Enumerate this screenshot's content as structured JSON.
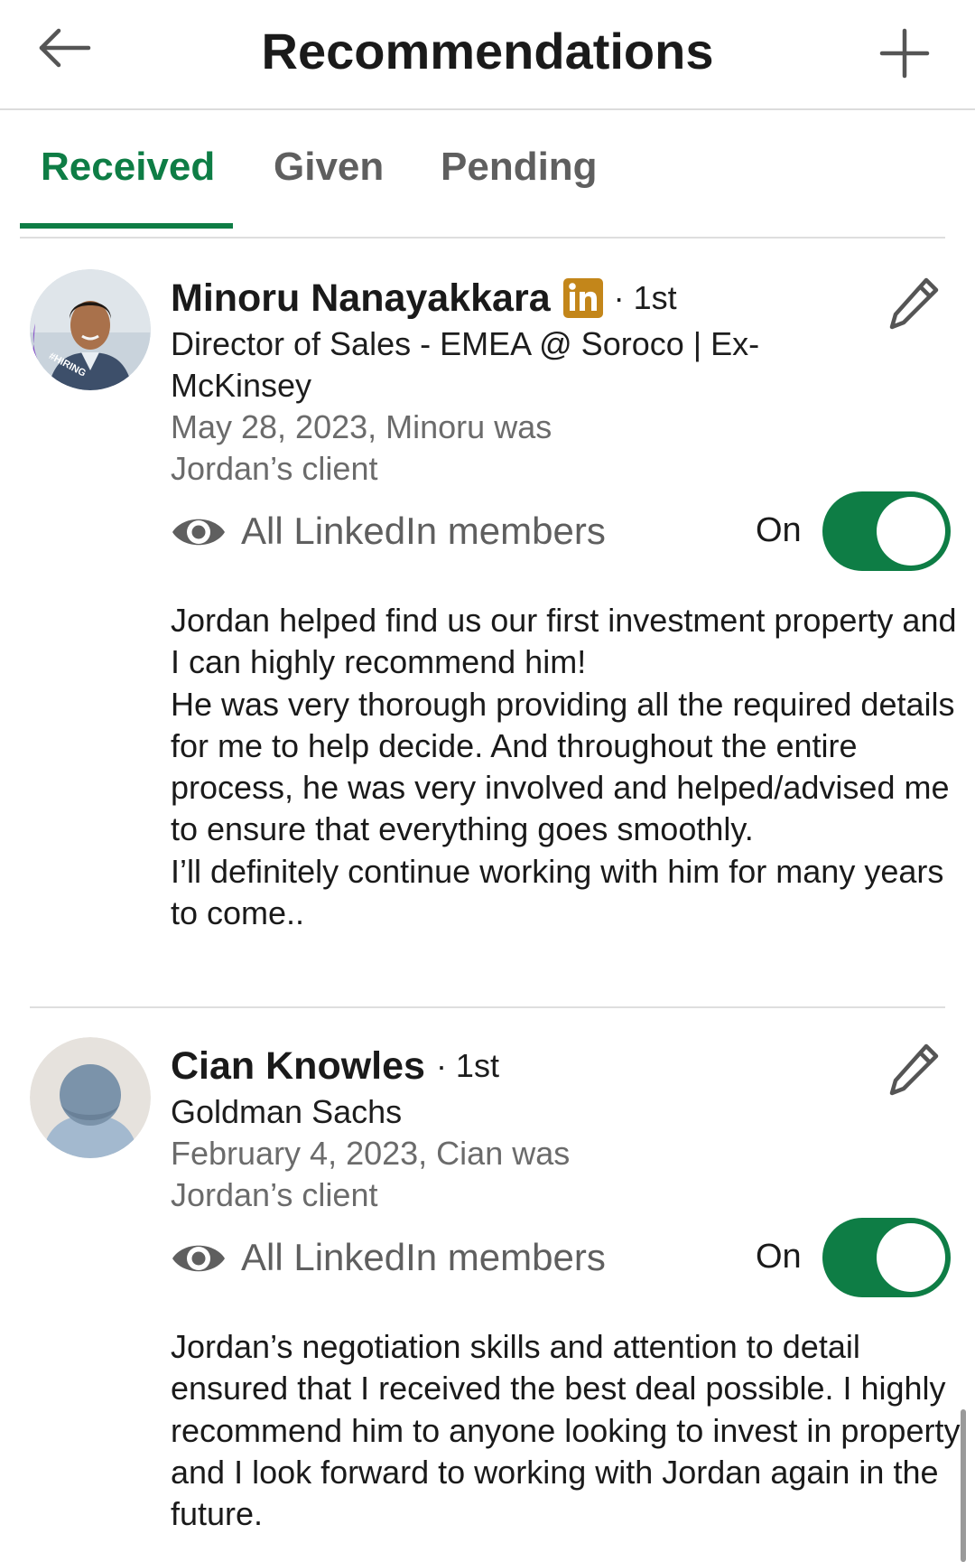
{
  "header": {
    "title": "Recommendations",
    "back_icon": "arrow-left-icon",
    "add_icon": "plus-icon"
  },
  "tabs": [
    {
      "label": "Received",
      "active": true
    },
    {
      "label": "Given",
      "active": false
    },
    {
      "label": "Pending",
      "active": false
    }
  ],
  "colors": {
    "accent": "#0e7d45",
    "premium_badge": "#c3861a",
    "hiring_frame": "#7e3fc7"
  },
  "recommendations": [
    {
      "name": "Minoru Nanayakkara",
      "premium_badge": "in",
      "degree": "· 1st",
      "headline": "Director of Sales - EMEA @ Soroco | Ex-McKinsey",
      "meta": "May 28, 2023, Minoru was Jordan’s client",
      "avatar_badge": "#HIRING",
      "visibility_label": "All LinkedIn members",
      "toggle_state": "On",
      "toggle_on": true,
      "text": [
        "Jordan helped find us our first investment property and I can highly recommend him!",
        "He was very thorough providing all the required details for me to help decide. And throughout the entire process, he was very involved and helped/advised me to ensure that everything goes smoothly.",
        "I’ll definitely continue working with him for many years to come.."
      ]
    },
    {
      "name": "Cian Knowles",
      "degree": "· 1st",
      "headline": "Goldman Sachs",
      "meta": "February 4, 2023, Cian was Jordan’s client",
      "visibility_label": "All LinkedIn members",
      "toggle_state": "On",
      "toggle_on": true,
      "text": [
        "Jordan’s negotiation skills and attention to detail ensured that I received the best deal possible. I highly recommend him to anyone looking to invest in property and I look forward to working with Jordan again in the future."
      ]
    }
  ]
}
